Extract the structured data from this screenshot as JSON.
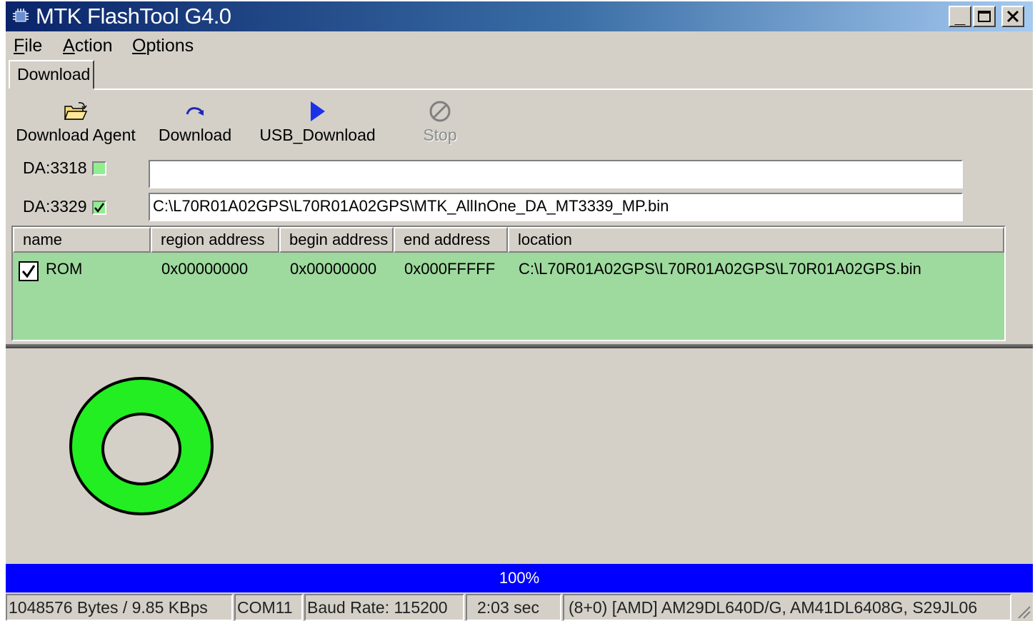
{
  "window": {
    "title": "MTK FlashTool G4.0"
  },
  "menu": [
    {
      "label_ul": "F",
      "label_rest": "ile"
    },
    {
      "label_ul": "A",
      "label_rest": "ction"
    },
    {
      "label_ul": "O",
      "label_rest": "ptions"
    }
  ],
  "tabs": {
    "active": "Download"
  },
  "toolbar": {
    "download_agent": "Download Agent",
    "download": "Download",
    "usb_download": "USB_Download",
    "stop": "Stop"
  },
  "da": [
    {
      "label": "DA:3318",
      "checked": false,
      "path": ""
    },
    {
      "label": "DA:3329",
      "checked": true,
      "path": "C:\\L70R01A02GPS\\L70R01A02GPS\\MTK_AllInOne_DA_MT3339_MP.bin"
    }
  ],
  "table": {
    "columns": [
      "name",
      "region address",
      "begin address",
      "end address",
      "location"
    ],
    "rows": [
      {
        "checked": true,
        "name": "ROM",
        "region": "0x00000000",
        "begin": "0x00000000",
        "end": "0x000FFFFF",
        "location": "C:\\L70R01A02GPS\\L70R01A02GPS\\L70R01A02GPS.bin"
      }
    ]
  },
  "status_indicator": {
    "color": "#22ee22"
  },
  "progress": {
    "percent": 100,
    "label": "100%"
  },
  "statusbar": {
    "bytes": "1048576 Bytes / 9.85 KBps",
    "port": "COM11",
    "baud": "Baud Rate: 115200",
    "time": "2:03 sec",
    "flash": "(8+0) [AMD] AM29DL640D/G, AM41DL6408G, S29JL06"
  }
}
